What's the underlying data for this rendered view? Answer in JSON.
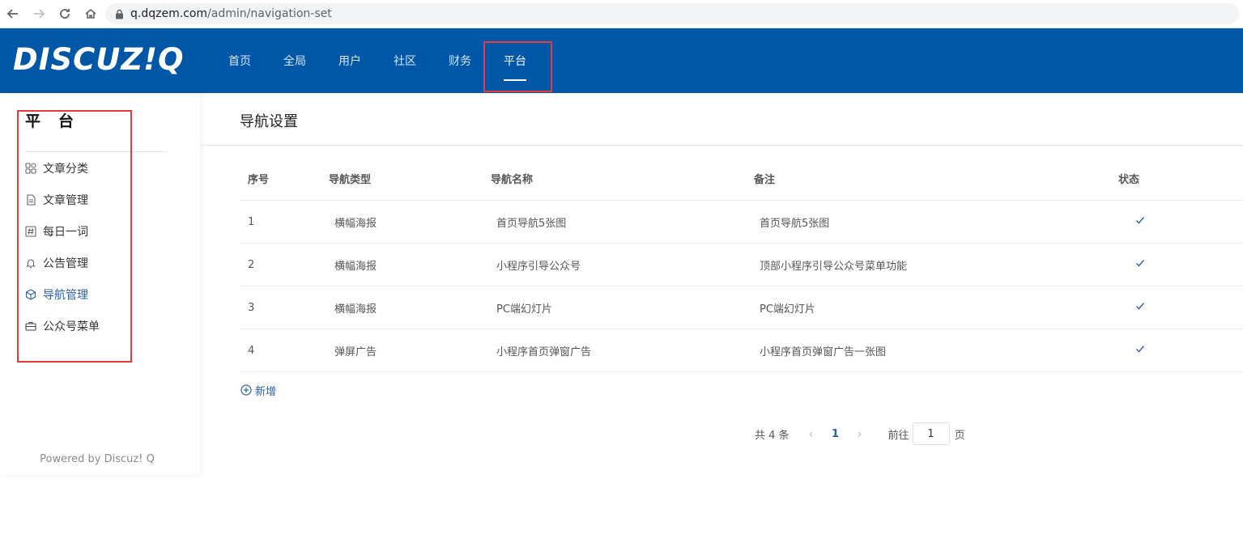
{
  "browser": {
    "url_host": "q.dqzem.com",
    "url_path": "/admin/navigation-set"
  },
  "header": {
    "logo": "DISCUZ!Q",
    "nav": [
      "首页",
      "全局",
      "用户",
      "社区",
      "财务",
      "平台"
    ],
    "active_nav": "平台"
  },
  "sidebar": {
    "title": "平台",
    "items": [
      {
        "label": "文章分类",
        "icon": "grid-icon"
      },
      {
        "label": "文章管理",
        "icon": "document-icon"
      },
      {
        "label": "每日一词",
        "icon": "hash-icon"
      },
      {
        "label": "公告管理",
        "icon": "bell-icon"
      },
      {
        "label": "导航管理",
        "icon": "cube-icon"
      },
      {
        "label": "公众号菜单",
        "icon": "briefcase-icon"
      }
    ],
    "active_item": "导航管理",
    "footer": "Powered by Discuz! Q"
  },
  "main": {
    "title": "导航设置",
    "table": {
      "headers": [
        "序号",
        "导航类型",
        "导航名称",
        "备注",
        "状态"
      ],
      "rows": [
        [
          "1",
          "横幅海报",
          "首页导航5张图",
          "首页导航5张图",
          "check"
        ],
        [
          "2",
          "横幅海报",
          "小程序引导公众号",
          "顶部小程序引导公众号菜单功能",
          "check"
        ],
        [
          "3",
          "横幅海报",
          "PC端幻灯片",
          "PC端幻灯片",
          "check"
        ],
        [
          "4",
          "弹屏广告",
          "小程序首页弹窗广告",
          "小程序首页弹窗广告一张图",
          "check"
        ]
      ]
    },
    "add_label": "新增",
    "pager": {
      "total": "共 4 条",
      "current_page": "1",
      "goto_prefix": "前往",
      "goto_value": "1",
      "goto_suffix": "页"
    }
  },
  "colors": {
    "header_bg": "#0056a7",
    "accent": "#2e5fa3",
    "highlight_box": "#e8393b"
  }
}
